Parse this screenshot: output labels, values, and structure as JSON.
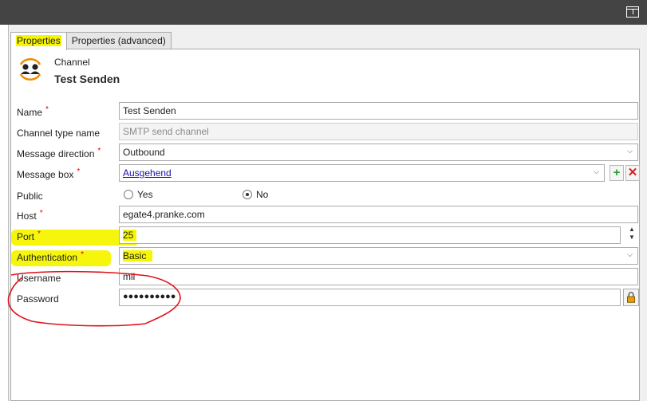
{
  "tabs": [
    {
      "label": "Properties",
      "active": true
    },
    {
      "label": "Properties (advanced)",
      "active": false
    }
  ],
  "channel": {
    "kind": "Channel",
    "name": "Test Senden"
  },
  "fields": {
    "name": {
      "label": "Name",
      "value": "Test Senden",
      "required": true
    },
    "channel_type": {
      "label": "Channel type name",
      "value": "SMTP send channel"
    },
    "direction": {
      "label": "Message direction",
      "value": "Outbound",
      "required": true
    },
    "message_box": {
      "label": "Message box",
      "value": "Ausgehend",
      "required": true
    },
    "public": {
      "label": "Public",
      "option_yes": "Yes",
      "option_no": "No",
      "selected": "No"
    },
    "host": {
      "label": "Host",
      "value": "egate4.pranke.com",
      "required": true
    },
    "port": {
      "label": "Port",
      "value": "25",
      "required": true
    },
    "authentication": {
      "label": "Authentication",
      "value": "Basic",
      "required": true
    },
    "username": {
      "label": "Username",
      "value": "mil"
    },
    "password": {
      "label": "Password",
      "value": "●●●●●●●●●●"
    }
  },
  "required_mark": "*",
  "icons": {
    "panel_toggle": "panel-toggle-icon",
    "channel": "channel-people-icon",
    "dropdown": "chevron-down-icon",
    "add": "plus-icon",
    "remove": "x-icon",
    "spin": "spinner-arrows-icon",
    "lock": "lock-icon"
  },
  "colors": {
    "highlight": "#f6f600",
    "annotation": "#e0101a",
    "required": "#e00000",
    "add_green": "#2d9b2d",
    "remove_red": "#d62020",
    "link": "#1a0dab"
  }
}
